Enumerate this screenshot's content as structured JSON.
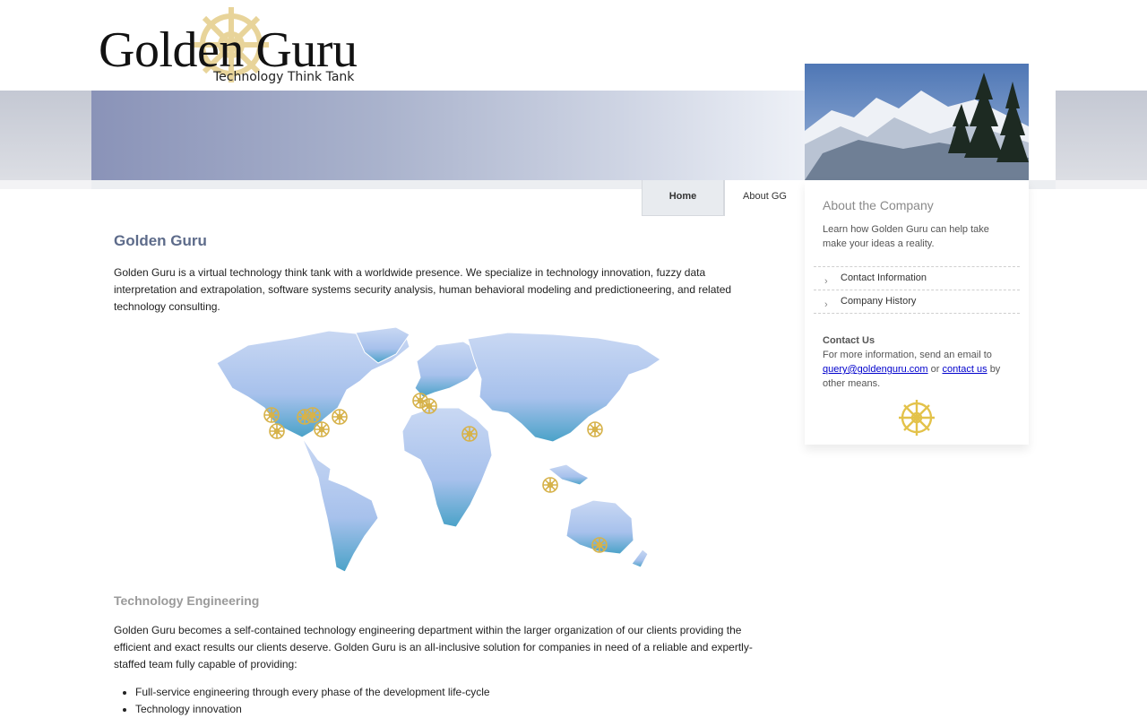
{
  "brand": {
    "name": "Golden Guru",
    "tagline": "Technology Think Tank"
  },
  "nav": {
    "tabs": [
      {
        "label": "Home",
        "active": true
      },
      {
        "label": "About GG",
        "active": false
      }
    ]
  },
  "main": {
    "title": "Golden Guru",
    "intro": "Golden Guru is a virtual technology think tank with a worldwide presence. We specialize in technology innovation, fuzzy data interpretation and extrapolation, software systems security analysis, human behavioral modeling and predictioneering, and related technology consulting.",
    "section_title": "Technology Engineering",
    "section_body": "Golden Guru becomes a self-contained technology engineering department within the larger organization of our clients providing the efficient and exact results our clients deserve. Golden Guru is an all-inclusive solution for companies in need of a reliable and expertly-staffed team fully capable of providing:",
    "bullets": [
      "Full-service engineering through every phase of the development life-cycle",
      "Technology innovation"
    ]
  },
  "sidebar": {
    "title": "About the Company",
    "description": "Learn how Golden Guru can help take make your ideas a reality.",
    "links": [
      "Contact Information",
      "Company History"
    ],
    "contact": {
      "heading": "Contact Us",
      "text_before": "For more information, send an email to",
      "email": "query@goldenguru.com",
      "or": "or",
      "contact_link": "contact us",
      "text_after": "by other means."
    }
  },
  "colors": {
    "accent": "#5d6b8a",
    "gold": "#e3c24a",
    "link": "#0000cc"
  }
}
